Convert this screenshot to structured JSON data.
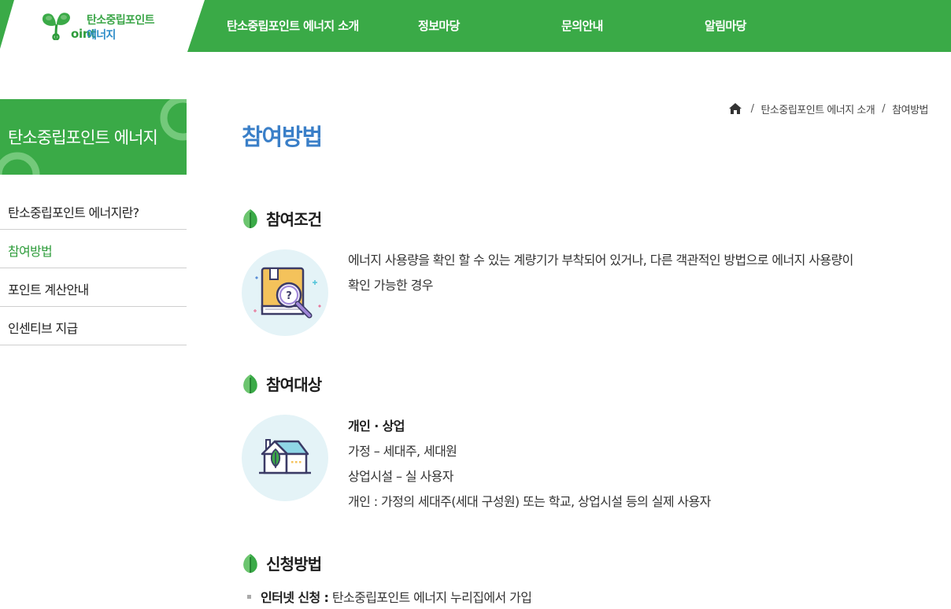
{
  "header": {
    "logo": {
      "oint": "oint",
      "line1": "탄소중립포인트",
      "line2": "에너지"
    },
    "nav": [
      {
        "label": "탄소중립포인트 에너지 소개"
      },
      {
        "label": "정보마당"
      },
      {
        "label": "문의안내"
      },
      {
        "label": "알림마당"
      }
    ]
  },
  "sidebar": {
    "title": "탄소중립포인트 에너지",
    "items": [
      {
        "label": "탄소중립포인트 에너지란?"
      },
      {
        "label": "참여방법"
      },
      {
        "label": "포인트 계산안내"
      },
      {
        "label": "인센티브 지급"
      }
    ],
    "active_index": 1
  },
  "breadcrumb": {
    "items": [
      "탄소중립포인트 에너지 소개",
      "참여방법"
    ],
    "separator": "/"
  },
  "page": {
    "title": "참여방법"
  },
  "sections": [
    {
      "title": "참여조건",
      "icon": "magnifier-book-icon",
      "lines": [
        "에너지 사용량을 확인 할 수 있는 계량기가 부착되어 있거나, 다른 객관적인 방법으로 에너지 사용량이",
        "확인 가능한 경우"
      ]
    },
    {
      "title": "참여대상",
      "icon": "house-leaf-icon",
      "heading": "개인 · 상업",
      "lines": [
        "가정 – 세대주, 세대원",
        "상업시설 – 실 사용자",
        "개인 : 가정의 세대주(세대 구성원) 또는 학교, 상업시설 등의 실제 사용자"
      ]
    },
    {
      "title": "신청방법",
      "bullets": [
        {
          "label": "인터넷 신청 :",
          "text": " 탄소중립포인트 에너지 누리집에서 가입"
        }
      ]
    }
  ],
  "colors": {
    "brand_green": "#3aaa47",
    "title_blue": "#3a7fc8",
    "active_green": "#2e9c3b",
    "icon_circle": "#e4f3f7"
  }
}
